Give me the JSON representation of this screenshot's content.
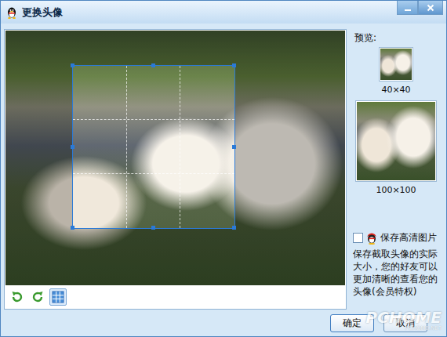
{
  "window": {
    "title": "更换头像"
  },
  "toolbar": {
    "tools": [
      {
        "kind": "rotate-left",
        "selected": false
      },
      {
        "kind": "rotate-right",
        "selected": false
      },
      {
        "kind": "grid",
        "selected": true
      }
    ]
  },
  "preview": {
    "label": "预览:",
    "sizes": [
      {
        "label": "40×40"
      },
      {
        "label": "100×100"
      }
    ]
  },
  "hd_option": {
    "label": "保存高清图片",
    "checked": false,
    "description": "保存截取头像的实际大小，您的好友可以更加清晰的查看您的头像(会员特权)"
  },
  "buttons": [
    {
      "label": "确定"
    },
    {
      "label": "取消"
    }
  ],
  "watermark": {
    "brand": "PCHOME",
    "site": "PCHOME.NET"
  }
}
